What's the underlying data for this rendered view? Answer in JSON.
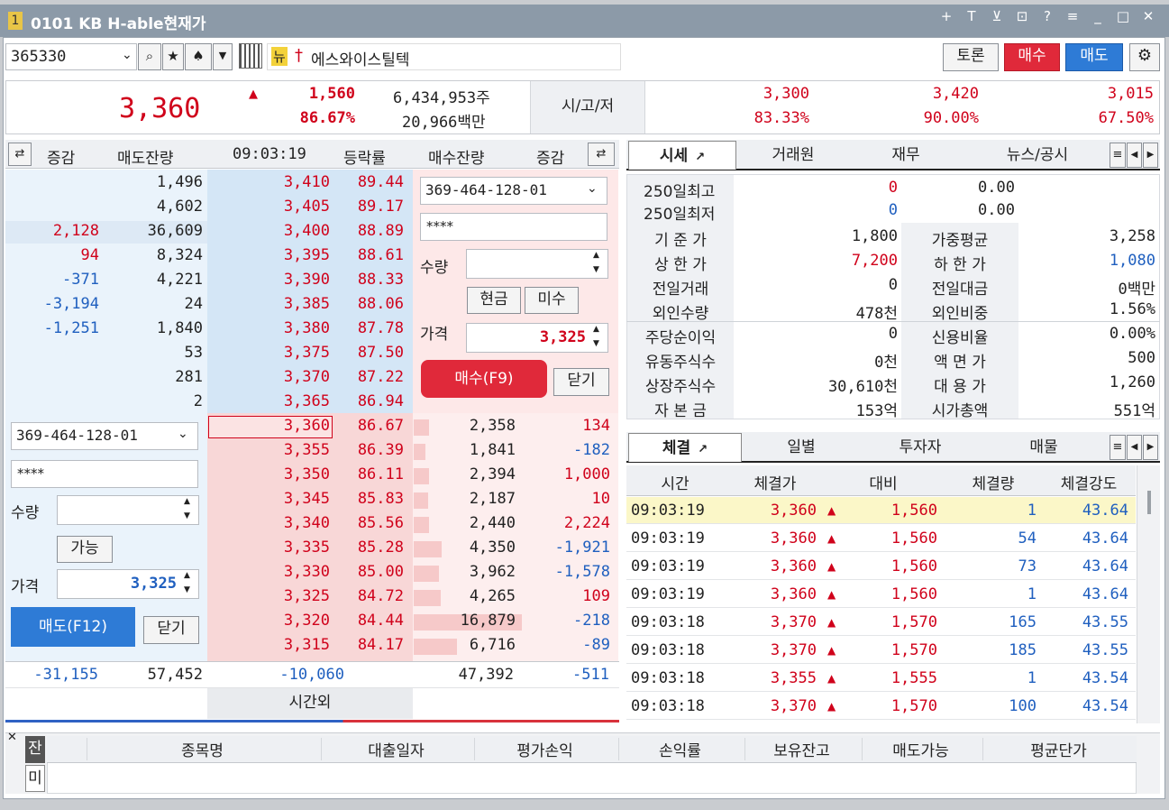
{
  "window": {
    "badge": "1",
    "title": "0101 KB H-able현재가",
    "controls": [
      "+",
      "T",
      "⊻",
      "⊡",
      "?",
      "≡",
      "_",
      "□",
      "✕"
    ]
  },
  "toolbar": {
    "code": "365330",
    "new_badge": "뉴",
    "name": "에스와이스틸텍",
    "debate": "토론",
    "buy": "매수",
    "sell": "매도"
  },
  "quote": {
    "price": "3,360",
    "change": "1,560",
    "rate": "86.67%",
    "volume": "6,434,953주",
    "amount": "20,966백만",
    "ohl_label": "시/고/저",
    "open": "3,300",
    "high": "3,420",
    "low": "3,015",
    "open_rate": "83.33%",
    "high_rate": "90.00%",
    "low_rate": "67.50%"
  },
  "orderbook": {
    "h_delta": "증감",
    "h_ask": "매도잔량",
    "h_time": "09:03:19",
    "h_rate": "등락률",
    "h_bid": "매수잔량",
    "h_delta2": "증감",
    "asks": [
      {
        "d": "",
        "q": "1,496",
        "p": "3,410",
        "r": "89.44"
      },
      {
        "d": "",
        "q": "4,602",
        "p": "3,405",
        "r": "89.17"
      },
      {
        "d": "2,128",
        "q": "36,609",
        "p": "3,400",
        "r": "88.89"
      },
      {
        "d": "94",
        "q": "8,324",
        "p": "3,395",
        "r": "88.61"
      },
      {
        "d": "-371",
        "q": "4,221",
        "p": "3,390",
        "r": "88.33"
      },
      {
        "d": "-3,194",
        "q": "24",
        "p": "3,385",
        "r": "88.06"
      },
      {
        "d": "-1,251",
        "q": "1,840",
        "p": "3,380",
        "r": "87.78"
      },
      {
        "d": "",
        "q": "53",
        "p": "3,375",
        "r": "87.50"
      },
      {
        "d": "",
        "q": "281",
        "p": "3,370",
        "r": "87.22"
      },
      {
        "d": "",
        "q": "2",
        "p": "3,365",
        "r": "86.94"
      }
    ],
    "bids": [
      {
        "p": "3,360",
        "r": "86.67",
        "q": "2,358",
        "d": "134"
      },
      {
        "p": "3,355",
        "r": "86.39",
        "q": "1,841",
        "d": "-182"
      },
      {
        "p": "3,350",
        "r": "86.11",
        "q": "2,394",
        "d": "1,000"
      },
      {
        "p": "3,345",
        "r": "85.83",
        "q": "2,187",
        "d": "10"
      },
      {
        "p": "3,340",
        "r": "85.56",
        "q": "2,440",
        "d": "2,224"
      },
      {
        "p": "3,335",
        "r": "85.28",
        "q": "4,350",
        "d": "-1,921"
      },
      {
        "p": "3,330",
        "r": "85.00",
        "q": "3,962",
        "d": "-1,578"
      },
      {
        "p": "3,325",
        "r": "84.72",
        "q": "4,265",
        "d": "109"
      },
      {
        "p": "3,320",
        "r": "84.44",
        "q": "16,879",
        "d": "-218"
      },
      {
        "p": "3,315",
        "r": "84.17",
        "q": "6,716",
        "d": "-89"
      }
    ],
    "total_ask_delta": "-31,155",
    "total_ask": "57,452",
    "total_mid": "-10,060",
    "total_bid": "47,392",
    "total_bid_delta": "-511",
    "after_hours": "시간외"
  },
  "buy_form": {
    "account": "369-464-128-01",
    "password": "****",
    "qty_label": "수량",
    "cash": "현금",
    "credit": "미수",
    "price_label": "가격",
    "price": "3,325",
    "submit": "매수(F9)",
    "close": "닫기"
  },
  "sell_form": {
    "account": "369-464-128-01",
    "password": "****",
    "qty_label": "수량",
    "avail": "가능",
    "price_label": "가격",
    "price": "3,325",
    "submit": "매도(F12)",
    "close": "닫기"
  },
  "info_tabs": [
    "시세",
    "거래원",
    "재무",
    "뉴스/공시"
  ],
  "info": {
    "hi250": "250일최고",
    "hi250v": "0",
    "hi250r": "0.00",
    "lo250": "250일최저",
    "lo250v": "0",
    "lo250r": "0.00",
    "rows": [
      {
        "l1": "기 준 가",
        "v1": "1,800",
        "l2": "가중평균",
        "v2": "3,258",
        "c1": "dk",
        "c2": "dk"
      },
      {
        "l1": "상 한 가",
        "v1": "7,200",
        "l2": "하 한 가",
        "v2": "1,080",
        "c1": "red",
        "c2": "blue"
      },
      {
        "l1": "전일거래",
        "v1": "0",
        "l2": "전일대금",
        "v2": "0백만",
        "c1": "dk",
        "c2": "dk"
      },
      {
        "l1": "외인수량",
        "v1": "478천",
        "l2": "외인비중",
        "v2": "1.56%",
        "c1": "dk",
        "c2": "dk"
      },
      {
        "l1": "주당순이익",
        "v1": "0",
        "l2": "신용비율",
        "v2": "0.00%",
        "c1": "dk",
        "c2": "dk"
      },
      {
        "l1": "유동주식수",
        "v1": "0천",
        "l2": "액 면 가",
        "v2": "500",
        "c1": "dk",
        "c2": "dk"
      },
      {
        "l1": "상장주식수",
        "v1": "30,610천",
        "l2": "대 용 가",
        "v2": "1,260",
        "c1": "dk",
        "c2": "dk"
      },
      {
        "l1": "자 본 금",
        "v1": "153억",
        "l2": "시가총액",
        "v2": "551억",
        "c1": "dk",
        "c2": "dk"
      }
    ]
  },
  "trade_tabs": [
    "체결",
    "일별",
    "투자자",
    "매물"
  ],
  "trades": {
    "headers": [
      "시간",
      "체결가",
      "대비",
      "체결량",
      "체결강도"
    ],
    "rows": [
      {
        "t": "09:03:19",
        "p": "3,360",
        "d": "1,560",
        "v": "1",
        "s": "43.64"
      },
      {
        "t": "09:03:19",
        "p": "3,360",
        "d": "1,560",
        "v": "54",
        "s": "43.64"
      },
      {
        "t": "09:03:19",
        "p": "3,360",
        "d": "1,560",
        "v": "73",
        "s": "43.64"
      },
      {
        "t": "09:03:19",
        "p": "3,360",
        "d": "1,560",
        "v": "1",
        "s": "43.64"
      },
      {
        "t": "09:03:18",
        "p": "3,370",
        "d": "1,570",
        "v": "165",
        "s": "43.55"
      },
      {
        "t": "09:03:18",
        "p": "3,370",
        "d": "1,570",
        "v": "185",
        "s": "43.55"
      },
      {
        "t": "09:03:18",
        "p": "3,355",
        "d": "1,555",
        "v": "1",
        "s": "43.54"
      },
      {
        "t": "09:03:18",
        "p": "3,370",
        "d": "1,570",
        "v": "100",
        "s": "43.54"
      }
    ]
  },
  "balance": {
    "side1": "잔",
    "side2": "미",
    "headers": [
      "종목명",
      "대출일자",
      "평가손익",
      "손익률",
      "보유잔고",
      "매도가능",
      "평균단가"
    ]
  }
}
